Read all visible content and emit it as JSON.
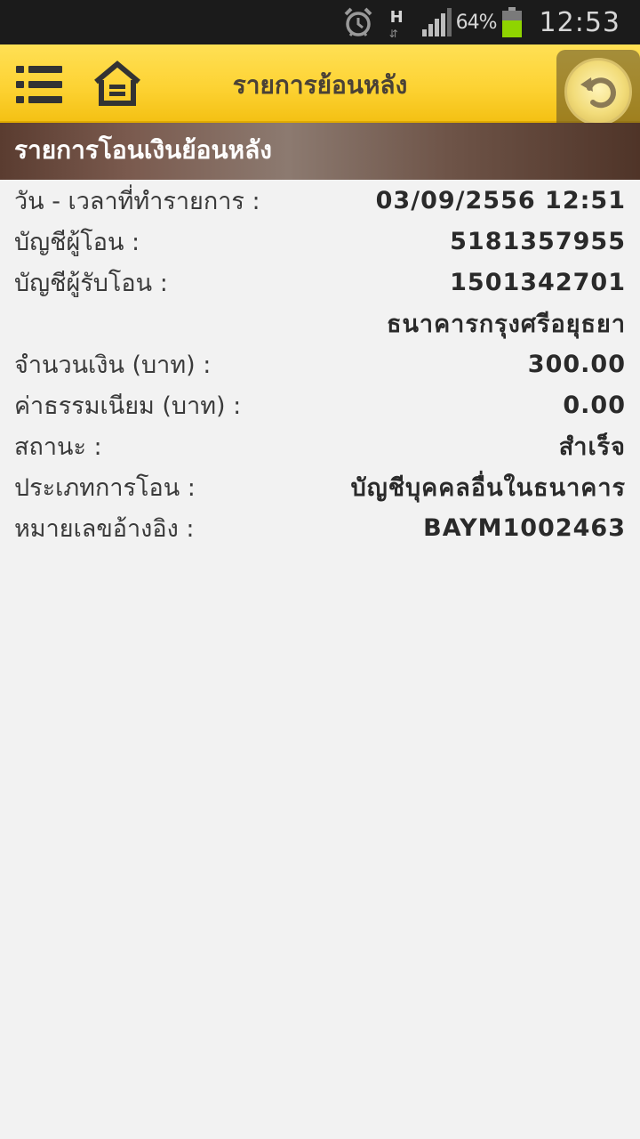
{
  "status_bar": {
    "alarm_icon": "alarm-clock-icon",
    "network_type": "H",
    "network_arrows": "⇵",
    "battery_percent": "64%",
    "battery_level": 0.64,
    "time": "12:53"
  },
  "header": {
    "title": "รายการย้อนหลัง",
    "menu_icon": "list-menu-icon",
    "home_icon": "home-icon",
    "back_icon": "back-arrow-icon"
  },
  "section": {
    "title": "รายการโอนเงินย้อนหลัง"
  },
  "details": {
    "datetime_label": "วัน - เวลาที่ทำรายการ :",
    "datetime_value": "03/09/2556 12:51",
    "from_account_label": "บัญชีผู้โอน :",
    "from_account_value": "5181357955",
    "to_account_label": "บัญชีผู้รับโอน :",
    "to_account_value": "1501342701",
    "to_bank_value": "ธนาคารกรุงศรีอยุธยา",
    "amount_label": "จำนวนเงิน (บาท) :",
    "amount_value": "300.00",
    "fee_label": "ค่าธรรมเนียม (บาท) :",
    "fee_value": "0.00",
    "status_label": "สถานะ :",
    "status_value": "สำเร็จ",
    "type_label": "ประเภทการโอน :",
    "type_value": "บัญชีบุคคลอื่นในธนาคาร",
    "reference_label": "หมายเลขอ้างอิง :",
    "reference_value": "BAYM1002463"
  },
  "colors": {
    "header_yellow": "#fdd334",
    "section_brown": "#6e5448",
    "page_background": "#f2f2f2",
    "battery_green": "#8fd400"
  }
}
